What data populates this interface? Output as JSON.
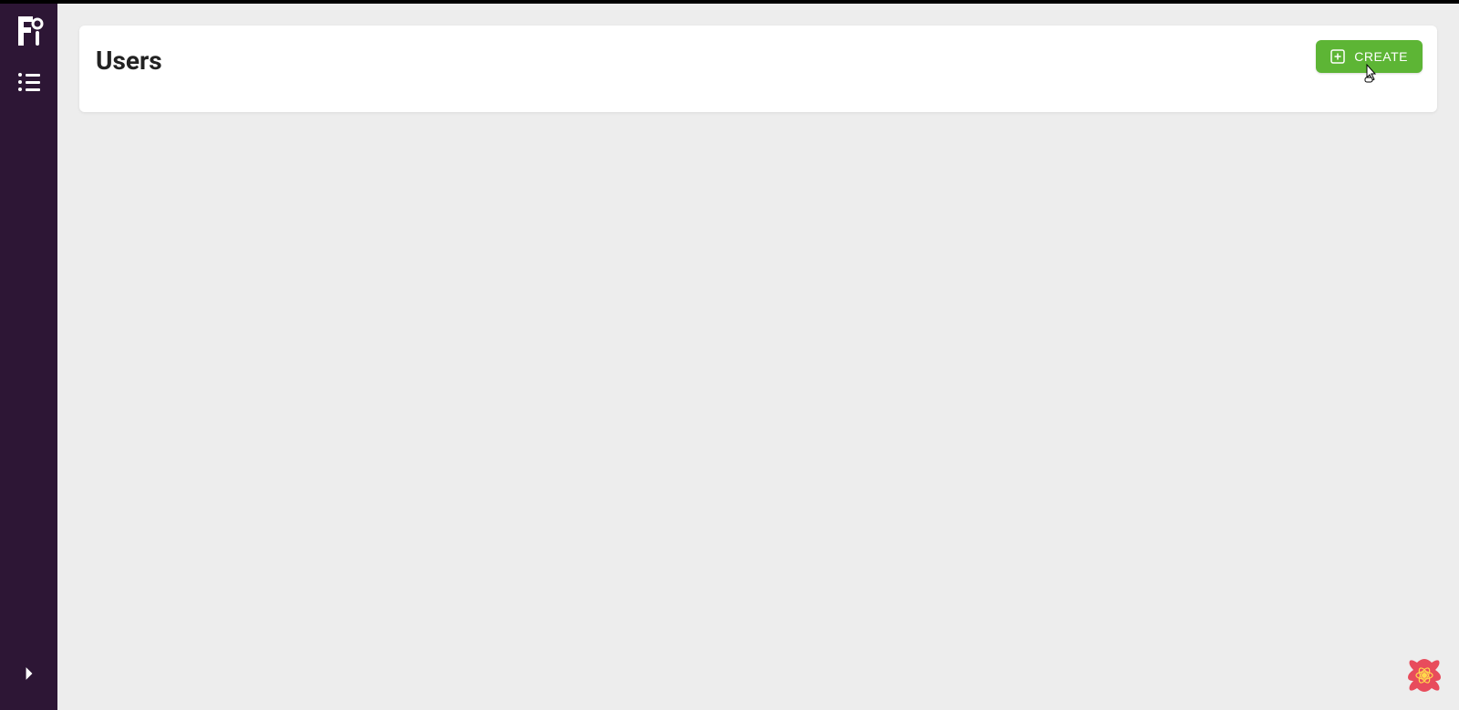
{
  "header": {
    "page_title": "Users",
    "create_button_label": "CREATE"
  },
  "colors": {
    "sidebar_bg": "#2d1635",
    "accent_green": "#5db535",
    "page_bg": "#ededed"
  }
}
